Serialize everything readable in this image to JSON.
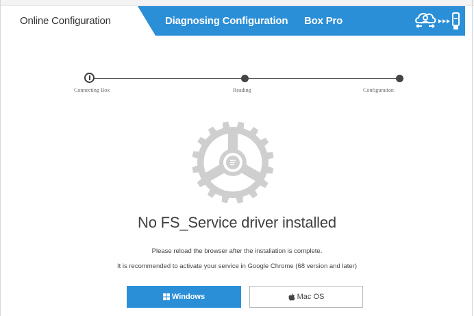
{
  "header": {
    "tabs": [
      {
        "label": "Online Configuration",
        "active": true
      },
      {
        "label": "Diagnosing Configuration",
        "active": false
      },
      {
        "label": "Box Pro",
        "active": false
      }
    ],
    "connection_icons": [
      "cloud-user-icon",
      "arrow-chain-icon",
      "usb-device-icon"
    ]
  },
  "stepper": {
    "steps": [
      {
        "label": "Connecting Box",
        "state": "current"
      },
      {
        "label": "Reading",
        "state": "pending"
      },
      {
        "label": "Configuration",
        "state": "pending"
      }
    ]
  },
  "status": {
    "icon": "gear-icon",
    "title": "No FS_Service driver installed",
    "note_1": "Please reload the browser after the installation is complete.",
    "note_2": "It is recommended to activate your service in Google Chrome (68 version and later)"
  },
  "downloads": {
    "windows_label": "Windows",
    "windows_icon": "windows-icon",
    "mac_label": "Mac OS",
    "mac_icon": "apple-icon"
  },
  "colors": {
    "accent": "#2b8fd8",
    "text_dark": "#404040",
    "gear": "#cfcfcf"
  }
}
